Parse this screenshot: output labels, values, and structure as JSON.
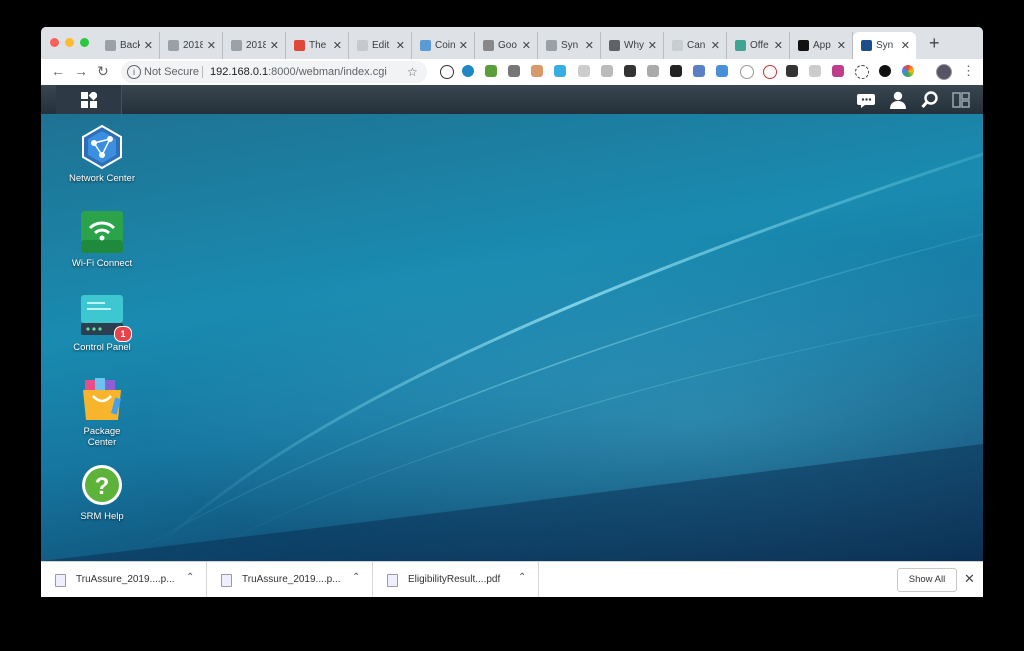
{
  "browser": {
    "tabs": [
      {
        "title": "Back",
        "icon": "doc-icon",
        "color": "#9aa0a6"
      },
      {
        "title": "2018",
        "icon": "doc-icon",
        "color": "#9aa0a6"
      },
      {
        "title": "2018",
        "icon": "doc-icon",
        "color": "#9aa0a6"
      },
      {
        "title": "The",
        "icon": "play-icon",
        "color": "#e1463b"
      },
      {
        "title": "Edit",
        "icon": "mail-icon",
        "color": "#c5c9ce"
      },
      {
        "title": "Coin",
        "icon": "c-icon",
        "color": "#5b9bd5"
      },
      {
        "title": "Goo",
        "icon": "bookmark-icon",
        "color": "#888888"
      },
      {
        "title": "Syn",
        "icon": "doc-icon",
        "color": "#9aa0a6"
      },
      {
        "title": "Why",
        "icon": "n-icon",
        "color": "#5f6368"
      },
      {
        "title": "Can",
        "icon": "syn-icon",
        "color": "#c8cdd2"
      },
      {
        "title": "Offe",
        "icon": "ring-icon",
        "color": "#3fa592"
      },
      {
        "title": "App",
        "icon": "apple-icon",
        "color": "#111111"
      },
      {
        "title": "Syn",
        "icon": "srm-icon",
        "color": "#1c4e8a",
        "active": true
      }
    ],
    "toolbar": {
      "security": "Not Secure",
      "url_host": "192.168.0.1",
      "url_path": ":8000/webman/index.cgi"
    }
  },
  "srm": {
    "taskbar": {
      "main_menu": "main-menu-icon",
      "tray": [
        "chat-icon",
        "user-icon",
        "search-icon",
        "widgets-icon"
      ]
    },
    "desktop_icons": [
      {
        "label": "Network Center",
        "icon": "network-center-icon"
      },
      {
        "label": "Wi-Fi Connect",
        "icon": "wifi-connect-icon"
      },
      {
        "label": "Control Panel",
        "icon": "control-panel-icon",
        "badge": "1"
      },
      {
        "label": "Package\nCenter",
        "icon": "package-center-icon"
      },
      {
        "label": "SRM Help",
        "icon": "help-icon"
      }
    ]
  },
  "downloads": {
    "items": [
      {
        "name": "TruAssure_2019....p..."
      },
      {
        "name": "TruAssure_2019....p..."
      },
      {
        "name": "EligibilityResult....pdf"
      }
    ],
    "show_all": "Show All"
  }
}
